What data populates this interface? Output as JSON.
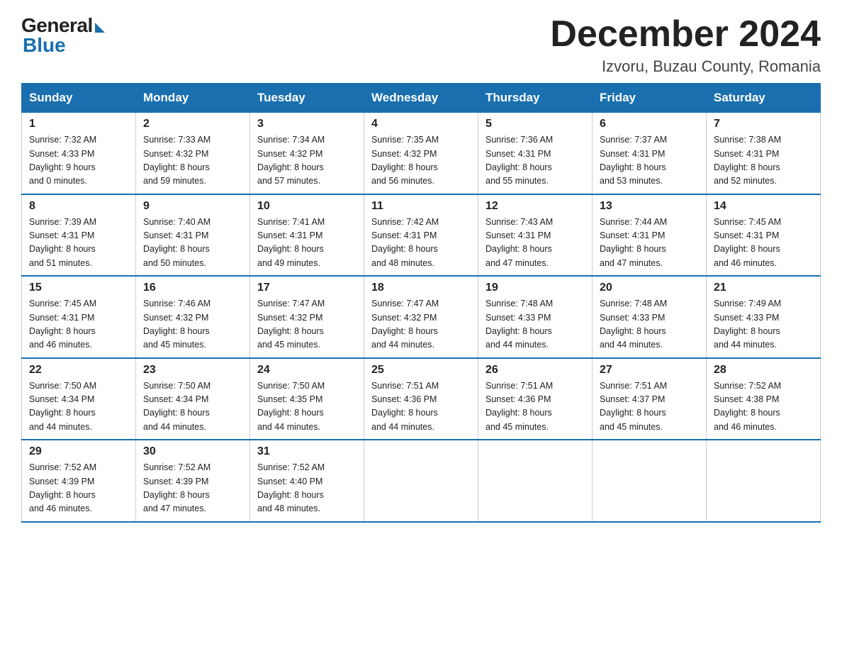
{
  "header": {
    "logo_general": "General",
    "logo_blue": "Blue",
    "month_title": "December 2024",
    "location": "Izvoru, Buzau County, Romania"
  },
  "days_of_week": [
    "Sunday",
    "Monday",
    "Tuesday",
    "Wednesday",
    "Thursday",
    "Friday",
    "Saturday"
  ],
  "weeks": [
    [
      {
        "day": "1",
        "sunrise": "7:32 AM",
        "sunset": "4:33 PM",
        "daylight": "9 hours and 0 minutes."
      },
      {
        "day": "2",
        "sunrise": "7:33 AM",
        "sunset": "4:32 PM",
        "daylight": "8 hours and 59 minutes."
      },
      {
        "day": "3",
        "sunrise": "7:34 AM",
        "sunset": "4:32 PM",
        "daylight": "8 hours and 57 minutes."
      },
      {
        "day": "4",
        "sunrise": "7:35 AM",
        "sunset": "4:32 PM",
        "daylight": "8 hours and 56 minutes."
      },
      {
        "day": "5",
        "sunrise": "7:36 AM",
        "sunset": "4:31 PM",
        "daylight": "8 hours and 55 minutes."
      },
      {
        "day": "6",
        "sunrise": "7:37 AM",
        "sunset": "4:31 PM",
        "daylight": "8 hours and 53 minutes."
      },
      {
        "day": "7",
        "sunrise": "7:38 AM",
        "sunset": "4:31 PM",
        "daylight": "8 hours and 52 minutes."
      }
    ],
    [
      {
        "day": "8",
        "sunrise": "7:39 AM",
        "sunset": "4:31 PM",
        "daylight": "8 hours and 51 minutes."
      },
      {
        "day": "9",
        "sunrise": "7:40 AM",
        "sunset": "4:31 PM",
        "daylight": "8 hours and 50 minutes."
      },
      {
        "day": "10",
        "sunrise": "7:41 AM",
        "sunset": "4:31 PM",
        "daylight": "8 hours and 49 minutes."
      },
      {
        "day": "11",
        "sunrise": "7:42 AM",
        "sunset": "4:31 PM",
        "daylight": "8 hours and 48 minutes."
      },
      {
        "day": "12",
        "sunrise": "7:43 AM",
        "sunset": "4:31 PM",
        "daylight": "8 hours and 47 minutes."
      },
      {
        "day": "13",
        "sunrise": "7:44 AM",
        "sunset": "4:31 PM",
        "daylight": "8 hours and 47 minutes."
      },
      {
        "day": "14",
        "sunrise": "7:45 AM",
        "sunset": "4:31 PM",
        "daylight": "8 hours and 46 minutes."
      }
    ],
    [
      {
        "day": "15",
        "sunrise": "7:45 AM",
        "sunset": "4:31 PM",
        "daylight": "8 hours and 46 minutes."
      },
      {
        "day": "16",
        "sunrise": "7:46 AM",
        "sunset": "4:32 PM",
        "daylight": "8 hours and 45 minutes."
      },
      {
        "day": "17",
        "sunrise": "7:47 AM",
        "sunset": "4:32 PM",
        "daylight": "8 hours and 45 minutes."
      },
      {
        "day": "18",
        "sunrise": "7:47 AM",
        "sunset": "4:32 PM",
        "daylight": "8 hours and 44 minutes."
      },
      {
        "day": "19",
        "sunrise": "7:48 AM",
        "sunset": "4:33 PM",
        "daylight": "8 hours and 44 minutes."
      },
      {
        "day": "20",
        "sunrise": "7:48 AM",
        "sunset": "4:33 PM",
        "daylight": "8 hours and 44 minutes."
      },
      {
        "day": "21",
        "sunrise": "7:49 AM",
        "sunset": "4:33 PM",
        "daylight": "8 hours and 44 minutes."
      }
    ],
    [
      {
        "day": "22",
        "sunrise": "7:50 AM",
        "sunset": "4:34 PM",
        "daylight": "8 hours and 44 minutes."
      },
      {
        "day": "23",
        "sunrise": "7:50 AM",
        "sunset": "4:34 PM",
        "daylight": "8 hours and 44 minutes."
      },
      {
        "day": "24",
        "sunrise": "7:50 AM",
        "sunset": "4:35 PM",
        "daylight": "8 hours and 44 minutes."
      },
      {
        "day": "25",
        "sunrise": "7:51 AM",
        "sunset": "4:36 PM",
        "daylight": "8 hours and 44 minutes."
      },
      {
        "day": "26",
        "sunrise": "7:51 AM",
        "sunset": "4:36 PM",
        "daylight": "8 hours and 45 minutes."
      },
      {
        "day": "27",
        "sunrise": "7:51 AM",
        "sunset": "4:37 PM",
        "daylight": "8 hours and 45 minutes."
      },
      {
        "day": "28",
        "sunrise": "7:52 AM",
        "sunset": "4:38 PM",
        "daylight": "8 hours and 46 minutes."
      }
    ],
    [
      {
        "day": "29",
        "sunrise": "7:52 AM",
        "sunset": "4:39 PM",
        "daylight": "8 hours and 46 minutes."
      },
      {
        "day": "30",
        "sunrise": "7:52 AM",
        "sunset": "4:39 PM",
        "daylight": "8 hours and 47 minutes."
      },
      {
        "day": "31",
        "sunrise": "7:52 AM",
        "sunset": "4:40 PM",
        "daylight": "8 hours and 48 minutes."
      },
      null,
      null,
      null,
      null
    ]
  ],
  "labels": {
    "sunrise": "Sunrise:",
    "sunset": "Sunset:",
    "daylight": "Daylight:"
  }
}
